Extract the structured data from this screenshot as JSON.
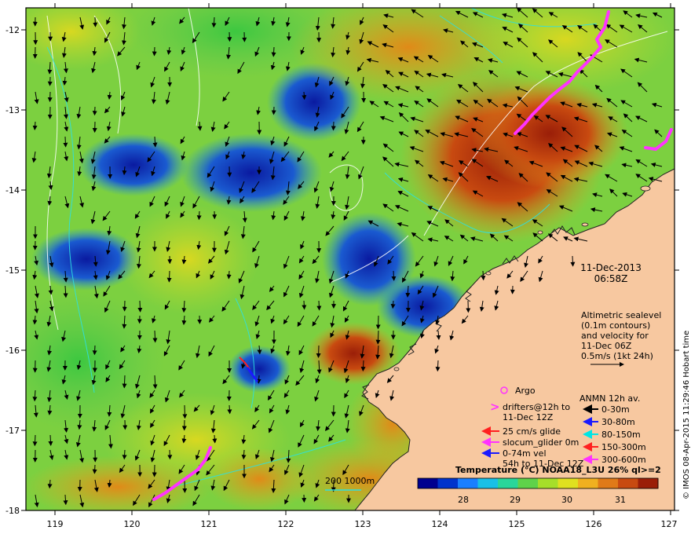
{
  "axes": {
    "x_ticks": [
      "119",
      "120",
      "121",
      "122",
      "123",
      "124",
      "125",
      "126",
      "127"
    ],
    "y_ticks": [
      "-12",
      "-13",
      "-14",
      "-15",
      "-16",
      "-17",
      "-18"
    ]
  },
  "timestamp": {
    "date": "11-Dec-2013",
    "time": "06:58Z"
  },
  "altimetry_note": {
    "lines": [
      "Altimetric sealevel",
      "(0.1m contours)",
      "and velocity for",
      "11-Dec 06Z",
      "0.5m/s (1kt 24h)"
    ]
  },
  "legend": {
    "argo": "Argo",
    "drifters_line1": "drifters@12h to",
    "drifters_line2": "11-Dec 12Z",
    "glide": "25 cm/s glide",
    "slocum": "slocum_glider 0m",
    "vel_line1": "0-74m vel",
    "vel_line2": "54h to 11-Dec 12Z",
    "anmn_title": "ANMN 12h av.",
    "anmn_items": [
      {
        "label": "0-30m",
        "color": "#000000"
      },
      {
        "label": "30-80m",
        "color": "#1a1aff"
      },
      {
        "label": "80-150m",
        "color": "#00e5e5"
      },
      {
        "label": "150-300m",
        "color": "#ff2020"
      },
      {
        "label": "300-600m",
        "color": "#ff33ff"
      }
    ],
    "depth_contours": "200  1000m"
  },
  "colorbar": {
    "title": "Temperature (°C) NOAA18_L3U 26% ql>=2",
    "ticks": [
      "28",
      "29",
      "30",
      "31"
    ],
    "colors": [
      "#00008f",
      "#0033cc",
      "#1a7fff",
      "#19c0e6",
      "#29d69a",
      "#5fd24a",
      "#a6de2a",
      "#e0e020",
      "#f0b020",
      "#e07a18",
      "#c84a10",
      "#9a1e08"
    ]
  },
  "copyright": "© IMOS 08-Apr-2015 11:29:46 Hobart time"
}
